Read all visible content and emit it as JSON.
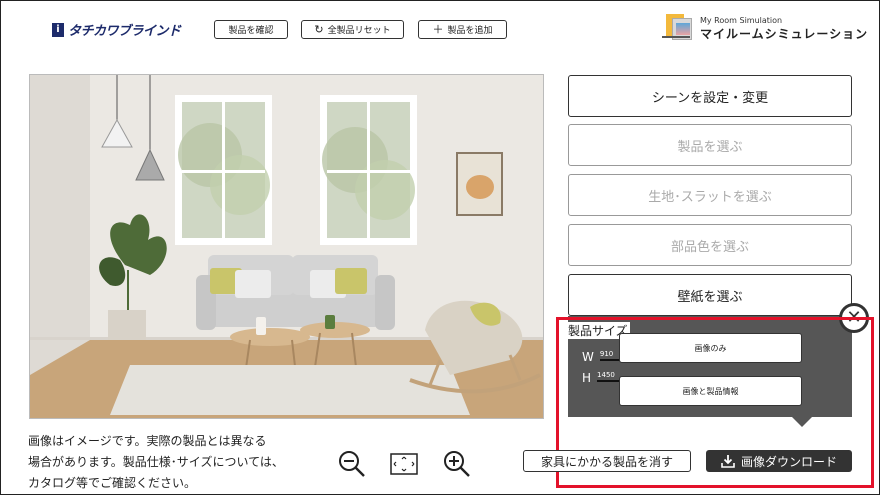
{
  "header": {
    "logo_mark": "i",
    "logo_text": "タチカワブラインド",
    "confirm_label": "製品を確認",
    "reset_label": "全製品リセット",
    "add_label": "製品を追加",
    "app_title_en": "My Room Simulation",
    "app_title_jp": "マイルームシミュレーション"
  },
  "menu": {
    "scene": "シーンを設定・変更",
    "product": "製品を選ぶ",
    "fabric": "生地･スラットを選ぶ",
    "parts_color": "部品色を選ぶ",
    "wallpaper": "壁紙を選ぶ"
  },
  "size_panel": {
    "title": "製品サイズ",
    "w_label": "W",
    "w_value": "910",
    "h_label": "H",
    "h_value": "1450"
  },
  "download_options": {
    "image_only": "画像のみ",
    "image_with_info": "画像と製品情報"
  },
  "note": {
    "line1": "画像はイメージです。実際の製品とは異なる",
    "line2": "場合があります。製品仕様･サイズについては、",
    "line3": "カタログ等でご確認ください。"
  },
  "actions": {
    "clear_label": "家具にかかる製品を消す",
    "download_label": "画像ダウンロード"
  },
  "colors": {
    "brand": "#1d2b6b",
    "highlight": "#e3122a",
    "panel": "#565656",
    "download_button": "#333333"
  },
  "icons": [
    "logo-icon",
    "reset-icon",
    "plus-icon",
    "simulation-icon",
    "close-icon",
    "zoom-out-icon",
    "fit-screen-icon",
    "zoom-in-icon",
    "download-icon"
  ]
}
